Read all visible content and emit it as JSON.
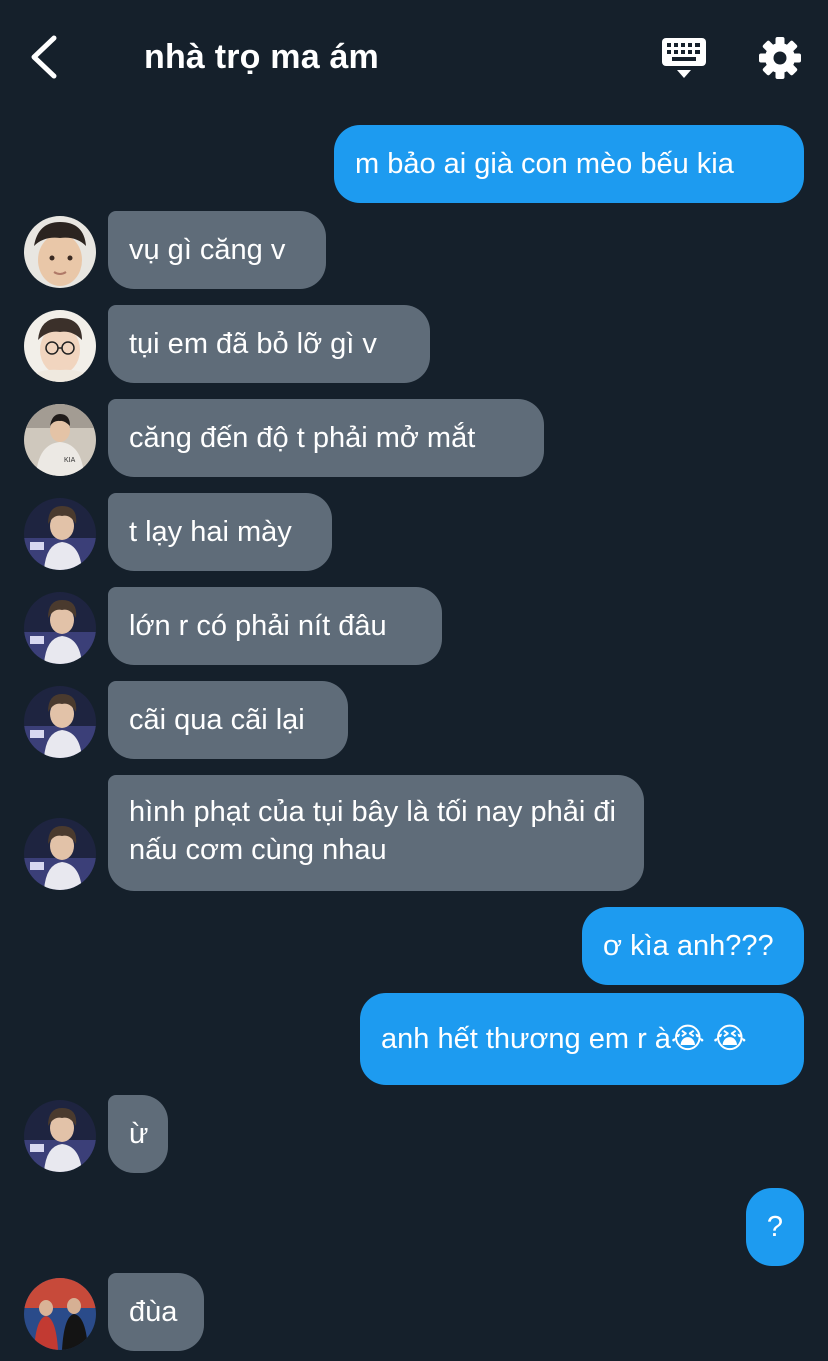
{
  "header": {
    "title": "nhà trọ ma ám"
  },
  "messages": [
    {
      "side": "out",
      "text": "m bảo ai già con mèo bếu kia"
    },
    {
      "side": "in",
      "text": "vụ gì căng v",
      "avatar": "avatar-user-1"
    },
    {
      "side": "in",
      "text": "tụi em đã bỏ lỡ gì v",
      "avatar": "avatar-user-2"
    },
    {
      "side": "in",
      "text": "căng đến độ t phải mở mắt",
      "avatar": "avatar-user-3"
    },
    {
      "side": "in",
      "text": "t lạy hai mày",
      "avatar": "avatar-user-4"
    },
    {
      "side": "in",
      "text": "lớn r có phải nít đâu",
      "avatar": "avatar-user-4"
    },
    {
      "side": "in",
      "text": "cãi qua cãi lại",
      "avatar": "avatar-user-4"
    },
    {
      "side": "in",
      "text": "hình phạt của tụi bây là tối nay phải đi nấu cơm cùng nhau",
      "avatar": "avatar-user-4"
    },
    {
      "side": "out",
      "text": "ơ kìa anh???"
    },
    {
      "side": "out",
      "text": "anh hết thương em r à😭 😭"
    },
    {
      "side": "in",
      "text": "ừ",
      "avatar": "avatar-user-4"
    },
    {
      "side": "out",
      "text": "?"
    },
    {
      "side": "in",
      "text": "đùa",
      "avatar": "avatar-user-5"
    }
  ],
  "colors": {
    "background": "#15202b",
    "incoming_bubble": "#5f6c79",
    "outgoing_bubble": "#1d9bf0",
    "text": "#ffffff"
  },
  "icons": {
    "back": "chevron-left-icon",
    "keyboard": "keyboard-icon",
    "settings": "gear-icon"
  }
}
